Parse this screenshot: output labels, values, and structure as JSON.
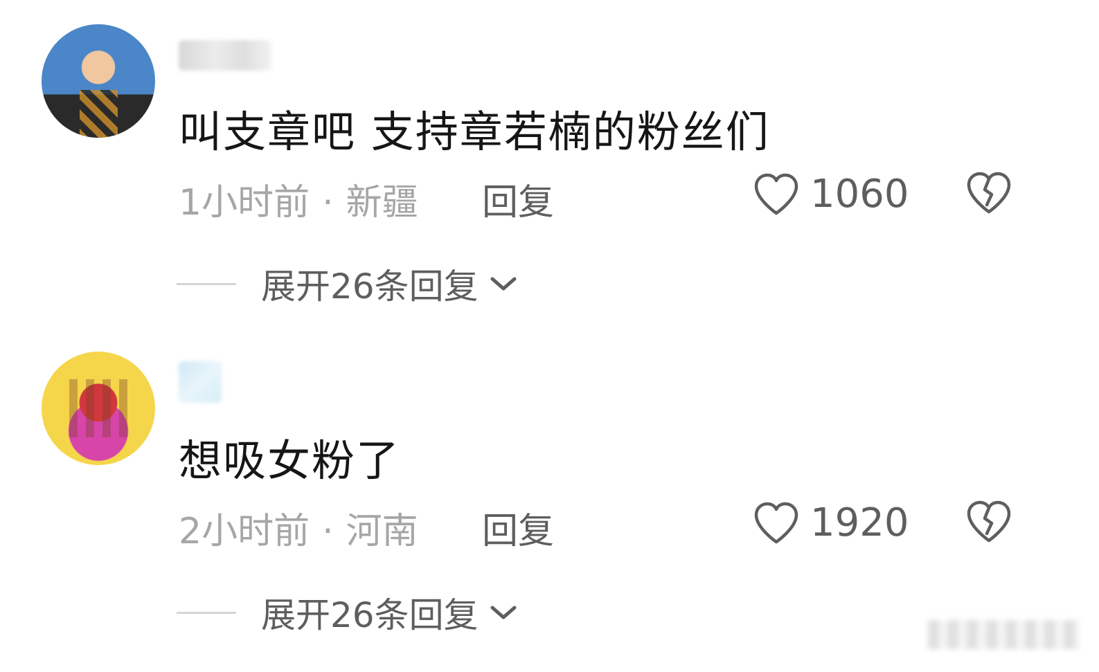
{
  "comments": [
    {
      "text": "叫支章吧 支持章若楠的粉丝们",
      "time": "1小时前",
      "dot": "·",
      "location": "新疆",
      "reply_label": "回复",
      "likes": "1060",
      "expand_label": "展开26条回复"
    },
    {
      "text": "想吸女粉了",
      "time": "2小时前",
      "dot": "·",
      "location": "河南",
      "reply_label": "回复",
      "likes": "1920",
      "expand_label": "展开26条回复"
    }
  ],
  "colors": {
    "text_primary": "#161616",
    "text_meta": "#a6a6a6",
    "text_action": "#5e5e5e",
    "divider": "#d4d4d4"
  },
  "icons": {
    "like": "heart-outline-icon",
    "dislike": "broken-heart-icon",
    "expand": "chevron-down-icon"
  }
}
